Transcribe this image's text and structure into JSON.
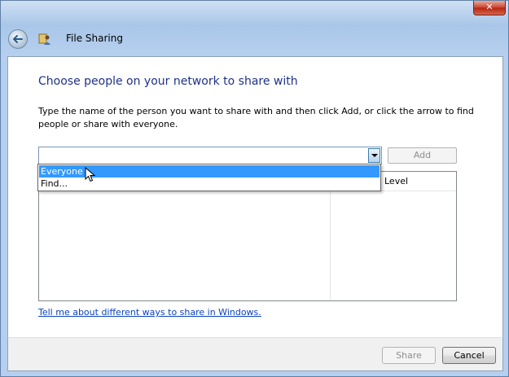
{
  "window": {
    "title": "File Sharing",
    "close_glyph": "✕"
  },
  "icons": {
    "back": "back-arrow-icon",
    "title": "file-sharing-icon"
  },
  "content": {
    "heading": "Choose people on your network to share with",
    "instructions": "Type the name of the person you want to share with and then click Add, or click the arrow to find people or share with everyone.",
    "combo_value": "",
    "add_label": "Add",
    "list_column_level": "Level",
    "help_link": "Tell me about different ways to share in Windows."
  },
  "dropdown": {
    "items": [
      {
        "label": "Everyone",
        "selected": true
      },
      {
        "label": "Find...",
        "selected": false
      }
    ]
  },
  "footer": {
    "share_label": "Share",
    "cancel_label": "Cancel"
  },
  "colors": {
    "heading": "#1e3287",
    "link": "#0b42c0",
    "selection": "#3399ff",
    "close_button": "#c9422f"
  }
}
